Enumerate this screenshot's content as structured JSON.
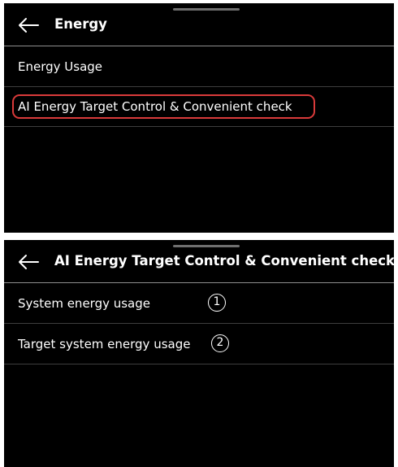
{
  "screen1": {
    "title": "Energy",
    "items": [
      {
        "label": "Energy Usage"
      },
      {
        "label": "AI Energy Target Control & Convenient check"
      }
    ]
  },
  "screen2": {
    "title": "AI Energy Target Control & Convenient check",
    "items": [
      {
        "label": "System energy usage",
        "callout": "1"
      },
      {
        "label": "Target system energy usage",
        "callout": "2"
      }
    ]
  },
  "colors": {
    "screen_bg": "#000000",
    "text": "#ffffff",
    "highlight": "#d93a3a",
    "divider": "#3e3e3e"
  },
  "icons": [
    "back-arrow-icon",
    "grab-handle"
  ]
}
